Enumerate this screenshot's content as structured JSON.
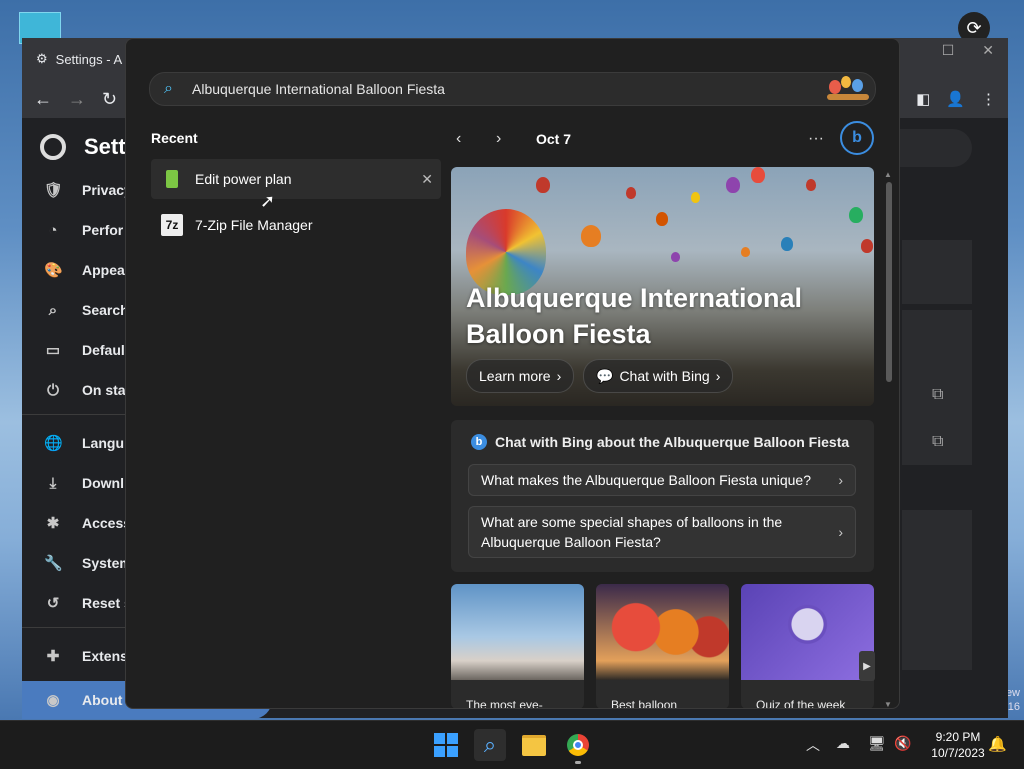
{
  "browser": {
    "tab_title": "Settings - A",
    "page_title": "Setti",
    "sidebar": [
      {
        "label": "Privacy",
        "icon": "shield-icon",
        "glyph": "🛡"
      },
      {
        "label": "Perfor",
        "icon": "speedometer-icon",
        "glyph": "◔"
      },
      {
        "label": "Appea",
        "icon": "palette-icon",
        "glyph": "🎨"
      },
      {
        "label": "Search",
        "icon": "search-icon",
        "glyph": "⌕"
      },
      {
        "label": "Defaul",
        "icon": "browser-icon",
        "glyph": "▭"
      },
      {
        "label": "On sta",
        "icon": "power-icon",
        "glyph": "⏻"
      },
      {
        "label": "Langu",
        "icon": "globe-icon",
        "glyph": "🌐"
      },
      {
        "label": "Downl",
        "icon": "download-icon",
        "glyph": "⤓"
      },
      {
        "label": "Access",
        "icon": "accessibility-icon",
        "glyph": "✱"
      },
      {
        "label": "System",
        "icon": "wrench-icon",
        "glyph": "🔧"
      },
      {
        "label": "Reset s",
        "icon": "reset-icon",
        "glyph": "↺"
      },
      {
        "label": "Extens",
        "icon": "puzzle-icon",
        "glyph": "✚"
      }
    ],
    "about_label": "About"
  },
  "search": {
    "query": "Albuquerque International Balloon Fiesta"
  },
  "recent": {
    "title": "Recent",
    "items": [
      {
        "label": "Edit power plan",
        "close": "✕"
      },
      {
        "label": "7-Zip File Manager",
        "icon_text": "7z"
      }
    ]
  },
  "highlights": {
    "date": "Oct 7",
    "more": "···",
    "bing_label": "b"
  },
  "hero": {
    "title": "Albuquerque International Balloon Fiesta",
    "learn_more": "Learn more",
    "chat": "Chat with Bing"
  },
  "chat_card": {
    "title": "Chat with Bing about the Albuquerque Balloon Fiesta",
    "questions": [
      "What makes the Albuquerque Balloon Fiesta unique?",
      "What are some special shapes of balloons in the Albuquerque Balloon Fiesta?"
    ]
  },
  "tiles": [
    {
      "caption": "The most eye-"
    },
    {
      "caption": "Best balloon"
    },
    {
      "caption": "Quiz of the week"
    }
  ],
  "taskbar": {
    "time": "9:20 PM",
    "date": "10/7/2023"
  },
  "desktop": {
    "edge_text_1": "ew",
    "edge_text_2": "16"
  }
}
